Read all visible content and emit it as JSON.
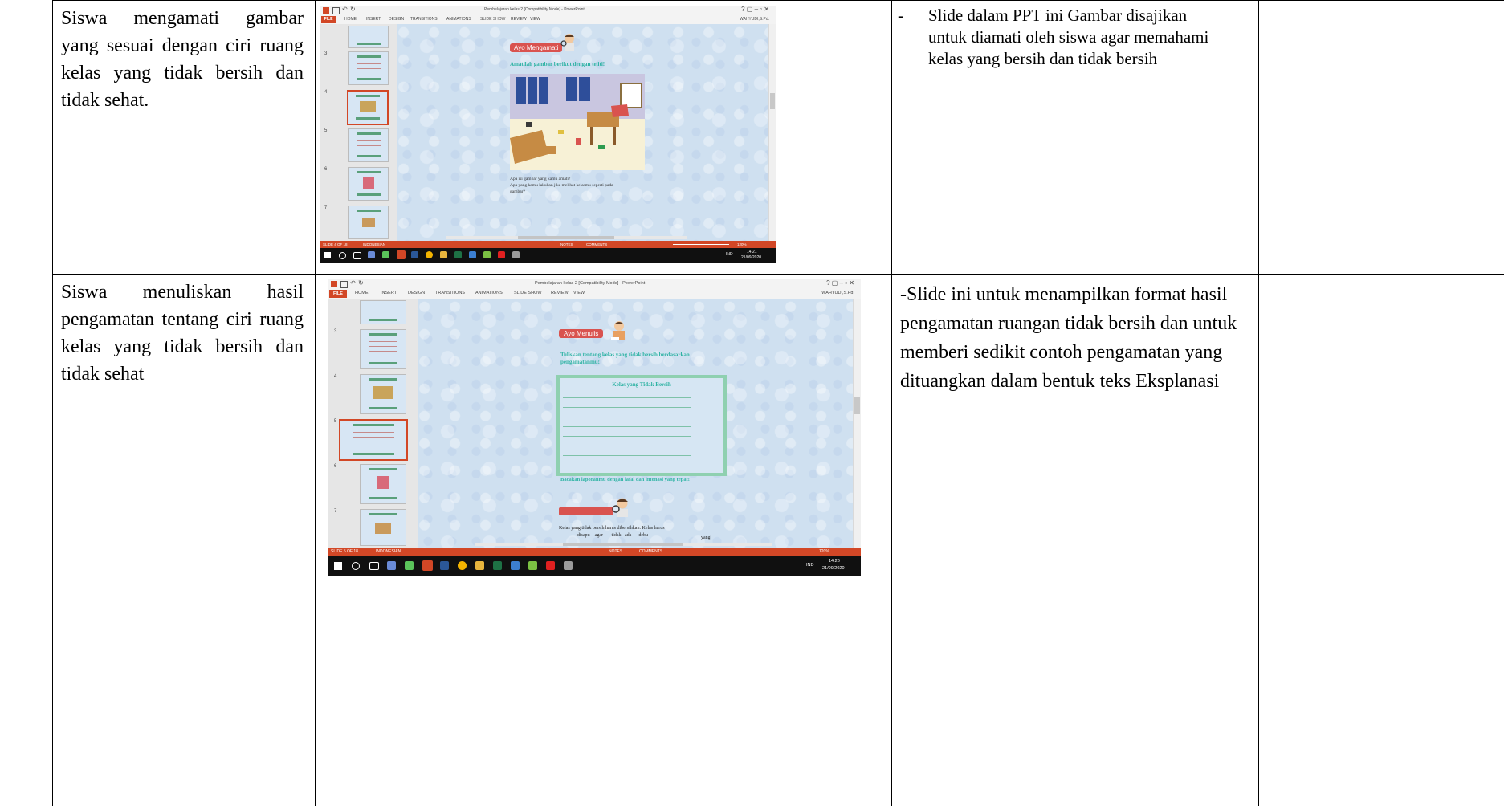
{
  "rows": [
    {
      "activity": "Siswa mengamati gambar yang sesuai dengan ciri ruang kelas yang tidak bersih dan tidak sehat.",
      "activity_lines": [
        "Siswa mengamati gambar",
        "yang sesuai dengan ciri ruang",
        "kelas yang tidak bersih dan",
        "tidak sehat."
      ],
      "note_bullet": "-",
      "note_lines": [
        "Slide dalam PPT  ini Gambar disajikan",
        "untuk diamati oleh siswa agar memahami",
        "kelas yang bersih dan tidak bersih"
      ],
      "screenshot": {
        "window_title": "Pembelajaran kelas 2 [Compatibility Mode] - PowerPoint",
        "user": "WAHYUDI,S.Pd.",
        "file_tab": "FILE",
        "ribbon_tabs": [
          "HOME",
          "INSERT",
          "DESIGN",
          "TRANSITIONS",
          "ANIMATIONS",
          "SLIDE SHOW",
          "REVIEW",
          "VIEW"
        ],
        "thumbnail_numbers": [
          "3",
          "4",
          "5",
          "6",
          "7"
        ],
        "slide_badge": "Ayo Mengamati",
        "slide_instruction": "Amatilah gambar berikut dengan teliti!",
        "slide_questions": [
          "Apa isi gambar yang kamu amati?",
          "Apa yang kamu lakukan jika melihat kelasmu seperti  pada",
          "gambar?"
        ],
        "status_left": "SLIDE 4 OF 18",
        "status_lang": "INDONESIAN",
        "status_notes": "NOTES",
        "status_comments": "COMMENTS",
        "zoom": "120%",
        "clock_time": "14.21",
        "clock_date": "21/09/2020",
        "lang_indicator": "IND"
      }
    },
    {
      "activity": "Siswa menuliskan hasil pengamatan tentang ciri ruang kelas yang tidak bersih dan tidak sehat",
      "activity_lines": [
        "Siswa menuliskan hasil",
        "pengamatan tentang ciri ruang",
        "kelas yang tidak bersih dan",
        "tidak sehat"
      ],
      "note_lines": [
        "-Slide ini untuk menampilkan format hasil",
        "pengamatan ruangan tidak bersih dan untuk",
        "memberi sedikit contoh pengamatan yang",
        "dituangkan dalam bentuk teks Eksplanasi"
      ],
      "screenshot": {
        "window_title": "Pembelajaran kelas 2 [Compatibility Mode] - PowerPoint",
        "user": "WAHYUDI,S.Pd.",
        "file_tab": "FILE",
        "ribbon_tabs": [
          "HOME",
          "INSERT",
          "DESIGN",
          "TRANSITIONS",
          "ANIMATIONS",
          "SLIDE SHOW",
          "REVIEW",
          "VIEW"
        ],
        "thumbnail_numbers": [
          "3",
          "4",
          "5",
          "6",
          "7"
        ],
        "slide_badge": "Ayo Menulis",
        "slide_instruction": "Tuliskan tentang kelas yang tidak bersih berdasarkan pengamatanmu!",
        "box_title": "Kelas yang Tidak Bersih",
        "read_instruction": "Bacakan laporanmu dengan lafal dan intonasi  yang tepat!",
        "example_lines": [
          "Kelas yang tidak bersih harus dibersihkan.  Kelas  harus",
          "disapu    agar       tidak   ada      debu",
          "yang"
        ],
        "status_left": "SLIDE 5 OF 18",
        "status_lang": "INDONESIAN",
        "status_notes": "NOTES",
        "status_comments": "COMMENTS",
        "zoom": "120%",
        "clock_time": "14.26",
        "clock_date": "21/09/2020",
        "lang_indicator": "IND"
      }
    }
  ]
}
